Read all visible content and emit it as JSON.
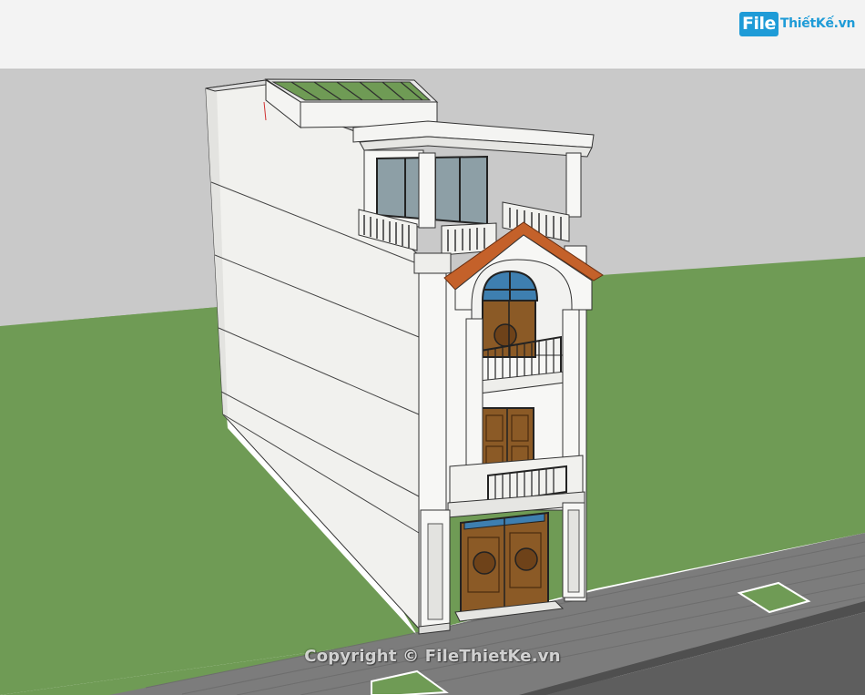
{
  "logo": {
    "file": "File",
    "rest": "ThiếtKế.vn"
  },
  "watermark": "Copyright © FileThietKe.vn",
  "colors": {
    "sky_band": "#f3f3f3",
    "ground_grey": "#c9c9c9",
    "grass": "#6f9b55",
    "wall_white": "#f7f7f5",
    "wall_side": "#efefec",
    "roof_tile": "#c4612a",
    "wood_door": "#8b5a26",
    "glass": "#8d9fa6",
    "arch_glass": "#3e7fb0",
    "pavement": "#7c7c7c",
    "road": "#5e5e5e",
    "logo_blue": "#1e9bd7"
  }
}
